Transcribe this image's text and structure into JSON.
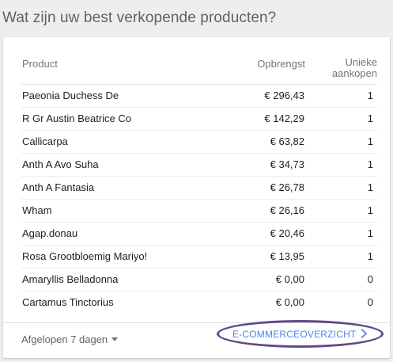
{
  "page": {
    "title": "Wat zijn uw best verkopende producten?"
  },
  "table": {
    "headers": {
      "product": "Product",
      "revenue": "Opbrengst",
      "purchases_line1": "Unieke",
      "purchases_line2": "aankopen"
    },
    "rows": [
      {
        "product": "Paeonia Duchess De",
        "revenue": "€ 296,43",
        "purchases": "1"
      },
      {
        "product": "R Gr Austin Beatrice Co",
        "revenue": "€ 142,29",
        "purchases": "1"
      },
      {
        "product": "Callicarpa",
        "revenue": "€ 63,82",
        "purchases": "1"
      },
      {
        "product": "Anth A Avo Suha",
        "revenue": "€ 34,73",
        "purchases": "1"
      },
      {
        "product": "Anth A Fantasia",
        "revenue": "€ 26,78",
        "purchases": "1"
      },
      {
        "product": "Wham",
        "revenue": "€ 26,16",
        "purchases": "1"
      },
      {
        "product": "Agap.donau",
        "revenue": "€ 20,46",
        "purchases": "1"
      },
      {
        "product": "Rosa Grootbloemig Mariyo!",
        "revenue": "€ 13,95",
        "purchases": "1"
      },
      {
        "product": "Amaryllis Belladonna",
        "revenue": "€ 0,00",
        "purchases": "0"
      },
      {
        "product": "Cartamus Tinctorius",
        "revenue": "€ 0,00",
        "purchases": "0"
      }
    ]
  },
  "footer": {
    "date_range": "Afgelopen 7 dagen",
    "overview_link": "E-COMMERCEOVERZICHT"
  },
  "icons": {
    "dropdown": "caret-down-icon",
    "link": "chevron-right-icon"
  },
  "colors": {
    "link": "#4a86e8",
    "highlight_oval": "#5b4a8b"
  }
}
